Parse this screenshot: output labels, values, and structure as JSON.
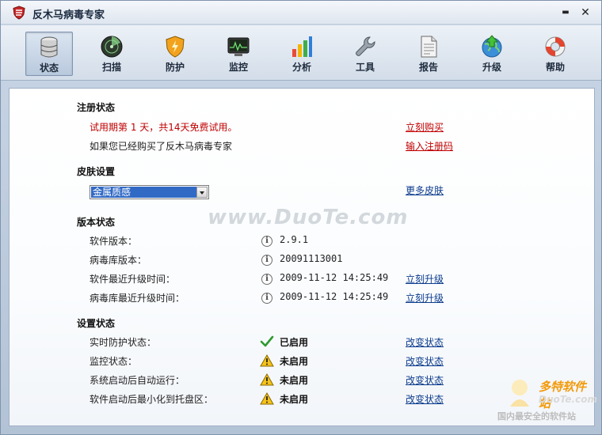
{
  "window": {
    "title": "反木马病毒专家",
    "minimize_label": "▬",
    "close_label": "✕"
  },
  "toolbar": {
    "items": [
      {
        "label": "状态",
        "icon": "database-icon",
        "active": true
      },
      {
        "label": "扫描",
        "icon": "radar-icon"
      },
      {
        "label": "防护",
        "icon": "shield-icon"
      },
      {
        "label": "监控",
        "icon": "monitor-icon"
      },
      {
        "label": "分析",
        "icon": "bar-chart-icon"
      },
      {
        "label": "工具",
        "icon": "wrench-icon"
      },
      {
        "label": "报告",
        "icon": "report-icon"
      },
      {
        "label": "升级",
        "icon": "upgrade-globe-icon"
      },
      {
        "label": "帮助",
        "icon": "lifebuoy-icon"
      }
    ]
  },
  "registration": {
    "title": "注册状态",
    "trial_text": "试用期第 1 天，共14天免费试用。",
    "buy_link": "立刻购买",
    "purchased_text": "如果您已经购买了反木马病毒专家",
    "register_link": "输入注册码"
  },
  "skin": {
    "title": "皮肤设置",
    "selected": "金属质感",
    "more_link": "更多皮肤"
  },
  "version": {
    "title": "版本状态",
    "rows": [
      {
        "label": "软件版本：",
        "value": "2.9.1",
        "link": ""
      },
      {
        "label": "病毒库版本：",
        "value": "20091113001",
        "link": ""
      },
      {
        "label": "软件最近升级时间：",
        "value": "2009-11-12 14:25:49",
        "link": "立刻升级"
      },
      {
        "label": "病毒库最近升级时间：",
        "value": "2009-11-12 14:25:49",
        "link": "立刻升级"
      }
    ]
  },
  "settings": {
    "title": "设置状态",
    "rows": [
      {
        "label": "实时防护状态：",
        "status": "已启用",
        "icon": "check-icon",
        "link": "改变状态"
      },
      {
        "label": "监控状态：",
        "status": "未启用",
        "icon": "warning-icon",
        "link": "改变状态"
      },
      {
        "label": "系统启动后自动运行：",
        "status": "未启用",
        "icon": "warning-icon",
        "link": "改变状态"
      },
      {
        "label": "软件启动后最小化到托盘区：",
        "status": "未启用",
        "icon": "warning-icon",
        "link": "改变状态"
      }
    ]
  },
  "watermark": {
    "text": "www.DuoTe.com",
    "brand": "多特软件站",
    "site": "DuoTe.com",
    "slogan": "国内最安全的软件站"
  },
  "colors": {
    "link": "#0b3b8c",
    "red": "#c00000",
    "select_highlight": "#316ac5"
  }
}
